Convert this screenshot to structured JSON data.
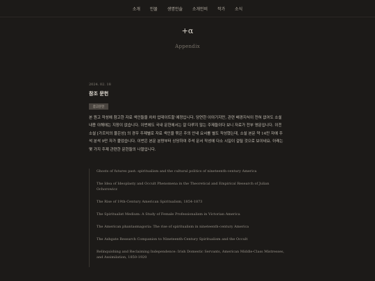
{
  "nav": {
    "items": [
      "소개",
      "인물",
      "생명인술",
      "소개인비",
      "작가",
      "소식"
    ]
  },
  "brand": {
    "title": "+α",
    "subtitle": "Appendix"
  },
  "post": {
    "date": "2024. 02. 18",
    "title": "참조 문헌",
    "badge": "참고문헌",
    "paragraph": "본 원고 작성에 참고한 자료 색인들을 차차 업데이트할 예정입니다. 당연한 이야기지만, 관련 배경지식이 전혀 없어도 소설 내용 이해에는 지장이 없습니다. 이번에도 국내 문헌에서는 잘 다루지 않는 주제들이다 보니 자료가 전부 영문입니다. 이전 소설 [가르치의 물은성] 의 경우 주제별로 자료 색인을 묶은 주의 안내 요서를 별도 작성했는데, 소설 본문 약 14만 자에 주석 분석 9만 자가 붙었습니다. 이번은 본문 분량부터 상당하여 주석 문서 작성에 다소 시일이 걸릴 것으로 보이네요. 아래는 몇 가지 주제 관련한 문헌들의 나열입니다."
  },
  "sources": [
    "Ghosts of futures past: spiritualism and the cultural politics of nineteenth-century America",
    "The Idea of Ideoplasty and Occult Phenomena in the Theoretical and Empirical Research of Julian Ochorowicz",
    "The Rise of 19th-Century American Spiritualism, 1854-1873",
    "The Spiritualist Medium: A Study of Female Professionalism in Victorian America",
    "The American phantasmagoria: The rise of spiritualism in nineteenth-century America",
    "The Ashgate Research Companion to Nineteenth-Century Spiritualism and the Occult",
    "Relinquishing and Reclaiming Independence: Irish Domestic Servants, American Middle-Class Mistresses, and Assimilation, 1850-1920"
  ]
}
